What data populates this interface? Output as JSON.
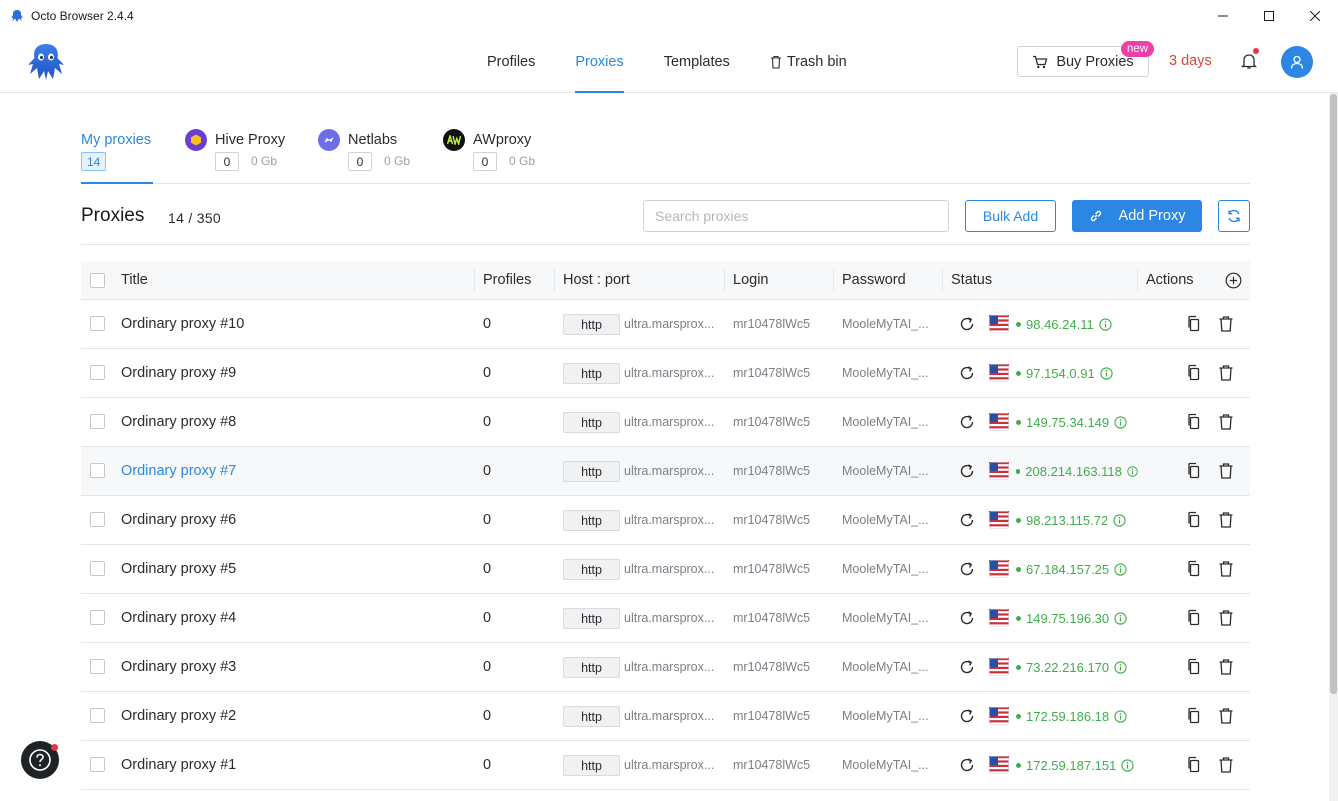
{
  "window": {
    "title": "Octo Browser 2.4.4"
  },
  "nav": {
    "items": [
      {
        "label": "Profiles",
        "active": false
      },
      {
        "label": "Proxies",
        "active": true
      },
      {
        "label": "Templates",
        "active": false
      },
      {
        "label": "Trash bin",
        "active": false
      }
    ]
  },
  "header": {
    "buy_label": "Buy Proxies",
    "new_badge": "new",
    "days_left": "3 days",
    "accent": "#2b87e3",
    "warning": "#e0433b"
  },
  "providers": [
    {
      "name": "My proxies",
      "count": "14",
      "gb": "",
      "active": true
    },
    {
      "name": "Hive Proxy",
      "count": "0",
      "gb": "0 Gb",
      "active": false
    },
    {
      "name": "Netlabs",
      "count": "0",
      "gb": "0 Gb",
      "active": false
    },
    {
      "name": "AWproxy",
      "count": "0",
      "gb": "0 Gb",
      "active": false
    }
  ],
  "toolbar": {
    "title": "Proxies",
    "count": "14 / 350",
    "search_placeholder": "Search proxies",
    "bulk_add": "Bulk Add",
    "add_proxy": "Add Proxy"
  },
  "table": {
    "columns": {
      "title": "Title",
      "profiles": "Profiles",
      "host": "Host : port",
      "login": "Login",
      "password": "Password",
      "status": "Status",
      "actions": "Actions"
    },
    "rows": [
      {
        "title": "Ordinary proxy #10",
        "profiles": "0",
        "protocol": "http",
        "host": "ultra.marsprox...",
        "login": "mr10478lWc5",
        "password": "MooleMyTAI_...",
        "ip": "98.46.24.11",
        "highlight": false
      },
      {
        "title": "Ordinary proxy #9",
        "profiles": "0",
        "protocol": "http",
        "host": "ultra.marsprox...",
        "login": "mr10478lWc5",
        "password": "MooleMyTAI_...",
        "ip": "97.154.0.91",
        "highlight": false
      },
      {
        "title": "Ordinary proxy #8",
        "profiles": "0",
        "protocol": "http",
        "host": "ultra.marsprox...",
        "login": "mr10478lWc5",
        "password": "MooleMyTAI_...",
        "ip": "149.75.34.149",
        "highlight": false
      },
      {
        "title": "Ordinary proxy #7",
        "profiles": "0",
        "protocol": "http",
        "host": "ultra.marsprox...",
        "login": "mr10478lWc5",
        "password": "MooleMyTAI_...",
        "ip": "208.214.163.118",
        "highlight": true
      },
      {
        "title": "Ordinary proxy #6",
        "profiles": "0",
        "protocol": "http",
        "host": "ultra.marsprox...",
        "login": "mr10478lWc5",
        "password": "MooleMyTAI_...",
        "ip": "98.213.115.72",
        "highlight": false
      },
      {
        "title": "Ordinary proxy #5",
        "profiles": "0",
        "protocol": "http",
        "host": "ultra.marsprox...",
        "login": "mr10478lWc5",
        "password": "MooleMyTAI_...",
        "ip": "67.184.157.25",
        "highlight": false
      },
      {
        "title": "Ordinary proxy #4",
        "profiles": "0",
        "protocol": "http",
        "host": "ultra.marsprox...",
        "login": "mr10478lWc5",
        "password": "MooleMyTAI_...",
        "ip": "149.75.196.30",
        "highlight": false
      },
      {
        "title": "Ordinary proxy #3",
        "profiles": "0",
        "protocol": "http",
        "host": "ultra.marsprox...",
        "login": "mr10478lWc5",
        "password": "MooleMyTAI_...",
        "ip": "73.22.216.170",
        "highlight": false
      },
      {
        "title": "Ordinary proxy #2",
        "profiles": "0",
        "protocol": "http",
        "host": "ultra.marsprox...",
        "login": "mr10478lWc5",
        "password": "MooleMyTAI_...",
        "ip": "172.59.186.18",
        "highlight": false
      },
      {
        "title": "Ordinary proxy #1",
        "profiles": "0",
        "protocol": "http",
        "host": "ultra.marsprox...",
        "login": "mr10478lWc5",
        "password": "MooleMyTAI_...",
        "ip": "172.59.187.151",
        "highlight": false
      }
    ]
  },
  "icons": {
    "status_ok_color": "#3fae4a",
    "flag": "us-flag-icon"
  }
}
